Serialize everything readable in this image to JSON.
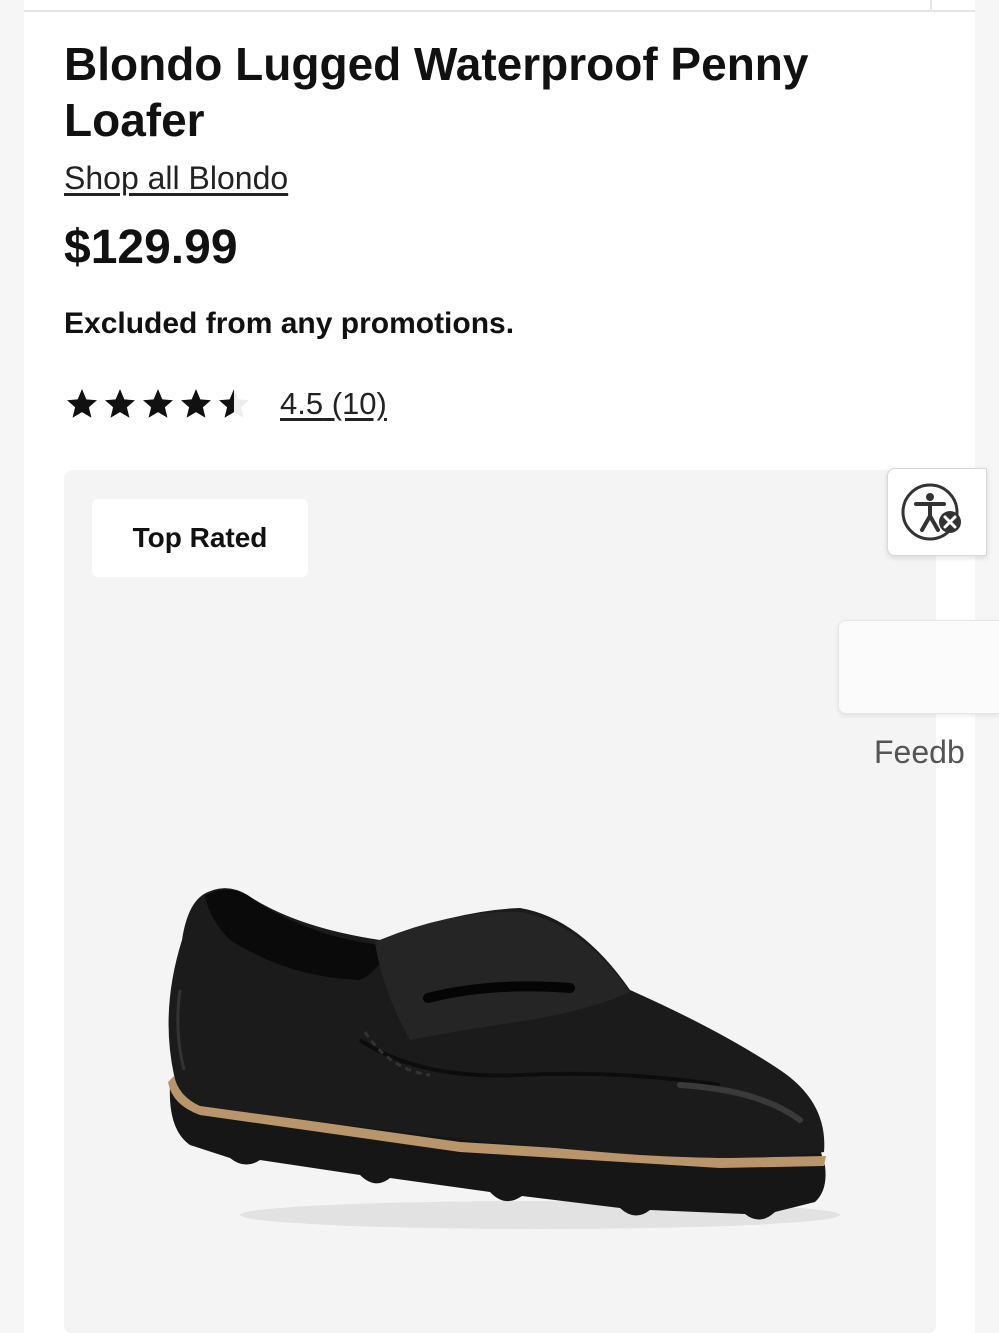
{
  "product": {
    "title": "Blondo Lugged Waterproof Penny Loafer",
    "shop_all_link": "Shop all Blondo",
    "price": "$129.99",
    "promo_note": "Excluded from any promotions.",
    "rating": {
      "score": "4.5",
      "count": "(10)",
      "stars_filled": 4.5,
      "stars_total": 5
    }
  },
  "gallery": {
    "badge": "Top Rated",
    "image_subject": "black leather penny loafer with lugged sole"
  },
  "accessibility_button": {
    "icon": "accessibility-icon"
  },
  "feedback": {
    "label": "Feedb"
  },
  "colors": {
    "text": "#111111",
    "gallery_bg": "#f4f4f4",
    "sole_accent": "#b8956a"
  }
}
